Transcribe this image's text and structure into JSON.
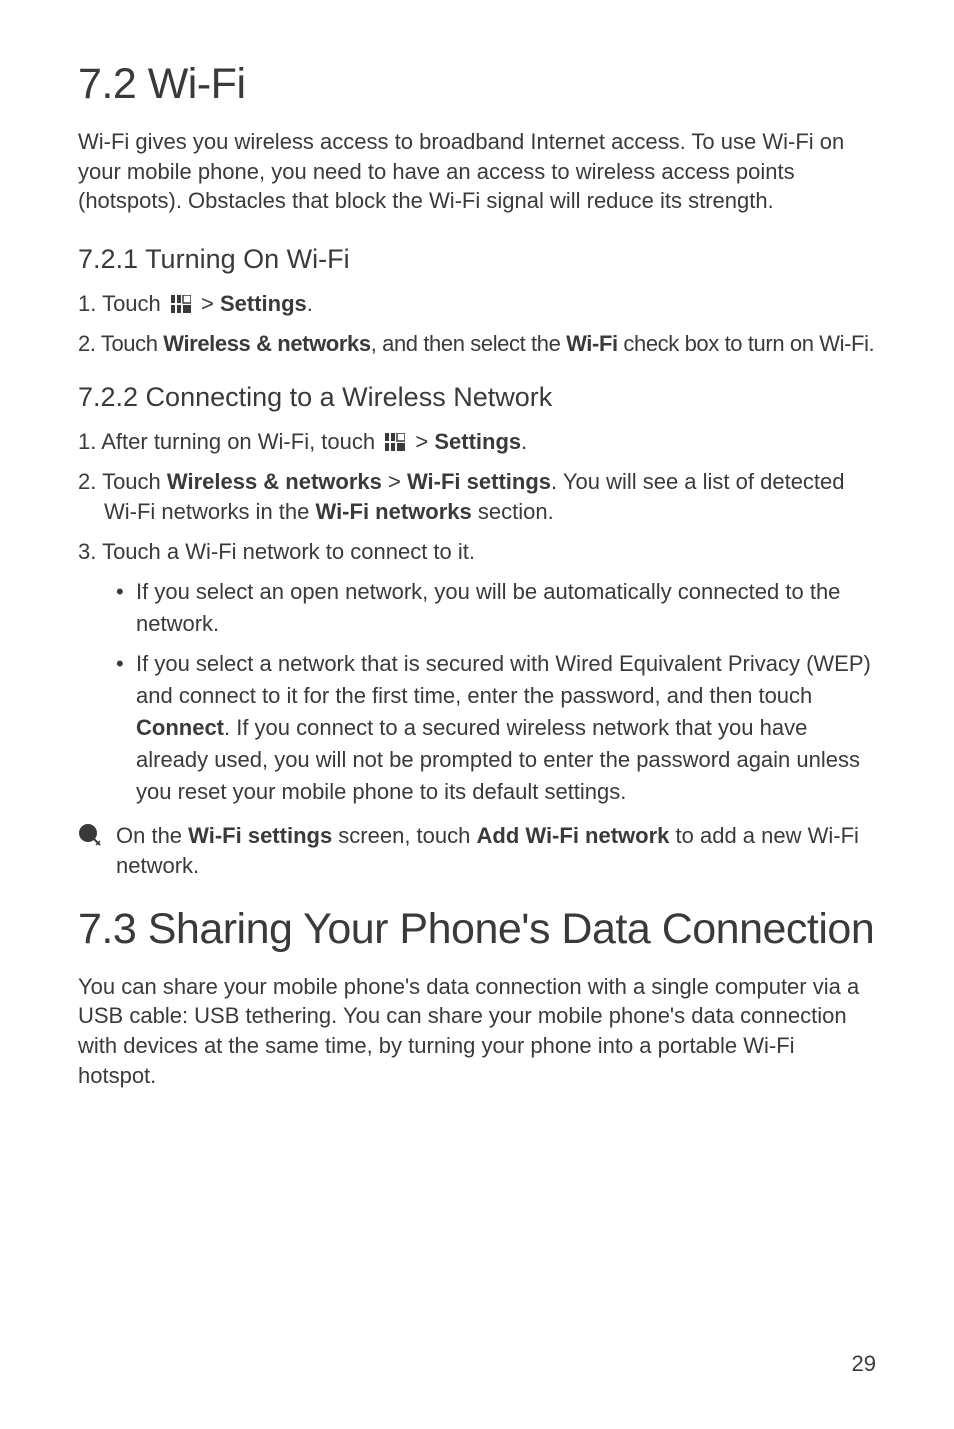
{
  "section_wifi": {
    "heading": "7.2  Wi-Fi",
    "intro": "Wi-Fi gives you wireless access to broadband Internet access. To use Wi-Fi on your mobile phone, you need to have an access to wireless access points (hotspots). Obstacles that block the Wi-Fi signal will reduce its strength.",
    "turning_on": {
      "heading": "7.2.1  Turning On Wi-Fi",
      "step1_prefix": "1. Touch ",
      "step1_suffix_a": " > ",
      "step1_suffix_b": "Settings",
      "step1_suffix_c": ".",
      "step2_a": "2. Touch ",
      "step2_b": "Wireless & networks",
      "step2_c": ", and then select the ",
      "step2_d": "Wi-Fi",
      "step2_e": " check box to turn on Wi-Fi."
    },
    "connecting": {
      "heading": "7.2.2  Connecting to a Wireless Network",
      "step1_prefix": "1. After turning on Wi-Fi, touch ",
      "step1_suffix_a": " > ",
      "step1_suffix_b": "Settings",
      "step1_suffix_c": ".",
      "step2_a": "2. Touch ",
      "step2_b": "Wireless & networks",
      "step2_c": " > ",
      "step2_d": "Wi-Fi settings",
      "step2_e": ". You will see a list of detected Wi-Fi networks in the ",
      "step2_f": "Wi-Fi networks",
      "step2_g": " section.",
      "step3": "3. Touch a Wi-Fi network to connect to it.",
      "bullet1": "If you select an open network, you will be automatically connected to the network.",
      "bullet2_a": "If you select a network that is secured with Wired Equivalent Privacy (WEP) and connect to it for the first time, enter the password, and then touch ",
      "bullet2_b": "Connect",
      "bullet2_c": ". If you connect to a secured wireless network that you have already used, you will not be prompted to enter the password again unless you reset your mobile phone to its default settings."
    },
    "note_a": "On the ",
    "note_b": "Wi-Fi settings",
    "note_c": " screen, touch ",
    "note_d": "Add Wi-Fi network",
    "note_e": " to add a new Wi-Fi network."
  },
  "section_sharing": {
    "heading": "7.3  Sharing Your Phone's Data Connection",
    "intro": "You can share your mobile phone's data connection with a single computer via a USB cable: USB tethering. You can share your mobile phone's data connection with devices at the same time, by turning your phone into a portable Wi-Fi hotspot."
  },
  "page_number": "29"
}
